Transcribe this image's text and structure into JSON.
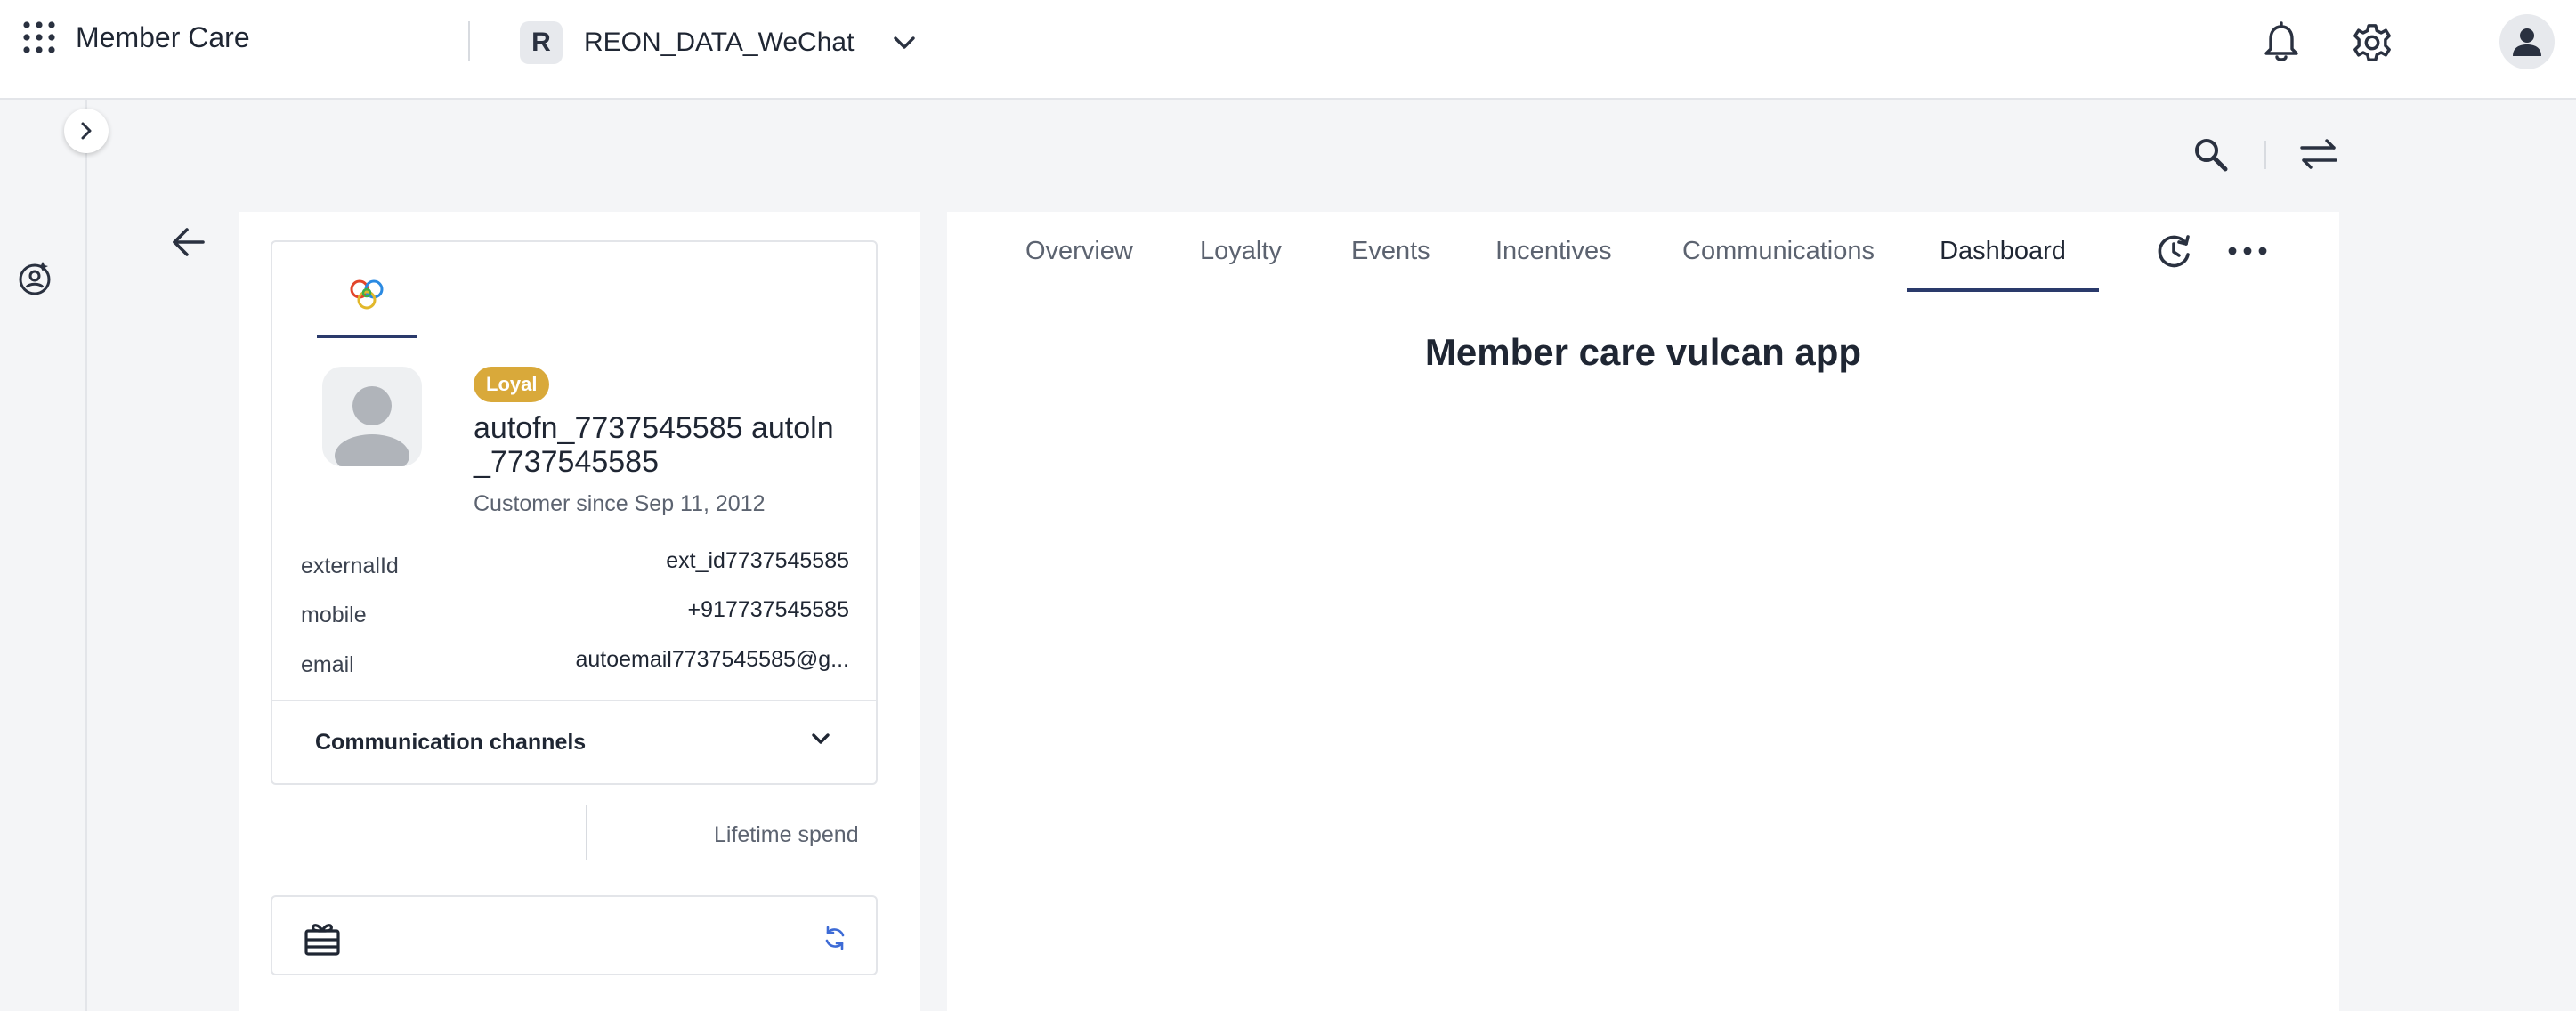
{
  "header": {
    "app_title": "Member Care",
    "org_initial": "R",
    "org_name": "REON_DATA_WeChat",
    "icons": {
      "apps": "apps-grid-icon",
      "org_dropdown": "chevron-down-icon",
      "notifications": "bell-icon",
      "settings": "gear-icon",
      "profile": "user-icon"
    }
  },
  "rail": {
    "icons": {
      "toggle": "chevron-right-icon",
      "member": "member-care-icon"
    }
  },
  "utilities": {
    "icons": {
      "search": "search-icon",
      "swap": "swap-icon",
      "back": "arrow-left-icon"
    }
  },
  "profile": {
    "tier": "Loyal",
    "name": "autofn_7737545585 autoln_7737545585",
    "since": "Customer since Sep 11, 2012",
    "fields": [
      {
        "label": "externalId",
        "value": "ext_id7737545585"
      },
      {
        "label": "mobile",
        "value": "+917737545585"
      },
      {
        "label": "email",
        "value": "autoemail7737545585@g..."
      }
    ],
    "communication_channels": "Communication channels",
    "lifetime_spend_label": "Lifetime spend"
  },
  "main": {
    "tabs": [
      {
        "label": "Overview",
        "active": false
      },
      {
        "label": "Loyalty",
        "active": false
      },
      {
        "label": "Events",
        "active": false
      },
      {
        "label": "Incentives",
        "active": false
      },
      {
        "label": "Communications",
        "active": false
      },
      {
        "label": "Dashboard",
        "active": true
      }
    ],
    "heading": "Member care vulcan app"
  },
  "colors": {
    "accent": "#2a3a6b",
    "tier_badge": "#d9a93a",
    "refresh_icon": "#3d6bd6"
  }
}
